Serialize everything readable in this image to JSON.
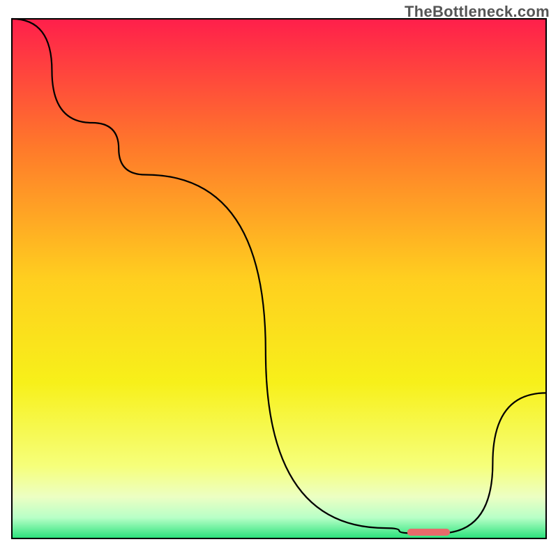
{
  "watermark": "TheBottleneck.com",
  "chart_data": {
    "type": "line",
    "title": "",
    "xlabel": "",
    "ylabel": "",
    "xlim": [
      0,
      100
    ],
    "ylim": [
      0,
      100
    ],
    "series": [
      {
        "name": "curve",
        "x": [
          0,
          15,
          25,
          70,
          75,
          80,
          100
        ],
        "y": [
          100,
          80,
          70,
          2,
          1,
          1,
          28
        ]
      }
    ],
    "marker": {
      "name": "optimal-range",
      "x_start": 74,
      "x_end": 82,
      "y": 1.2,
      "color": "#e86b6b"
    },
    "background_gradient": {
      "stops": [
        {
          "offset": 0,
          "color": "#ff1f4b"
        },
        {
          "offset": 25,
          "color": "#ff7a2a"
        },
        {
          "offset": 50,
          "color": "#ffcf1f"
        },
        {
          "offset": 70,
          "color": "#f7f01a"
        },
        {
          "offset": 86,
          "color": "#f6ff7a"
        },
        {
          "offset": 92,
          "color": "#ecffc3"
        },
        {
          "offset": 96,
          "color": "#b8ffc7"
        },
        {
          "offset": 100,
          "color": "#28e27a"
        }
      ]
    },
    "grid": false,
    "legend": false
  }
}
